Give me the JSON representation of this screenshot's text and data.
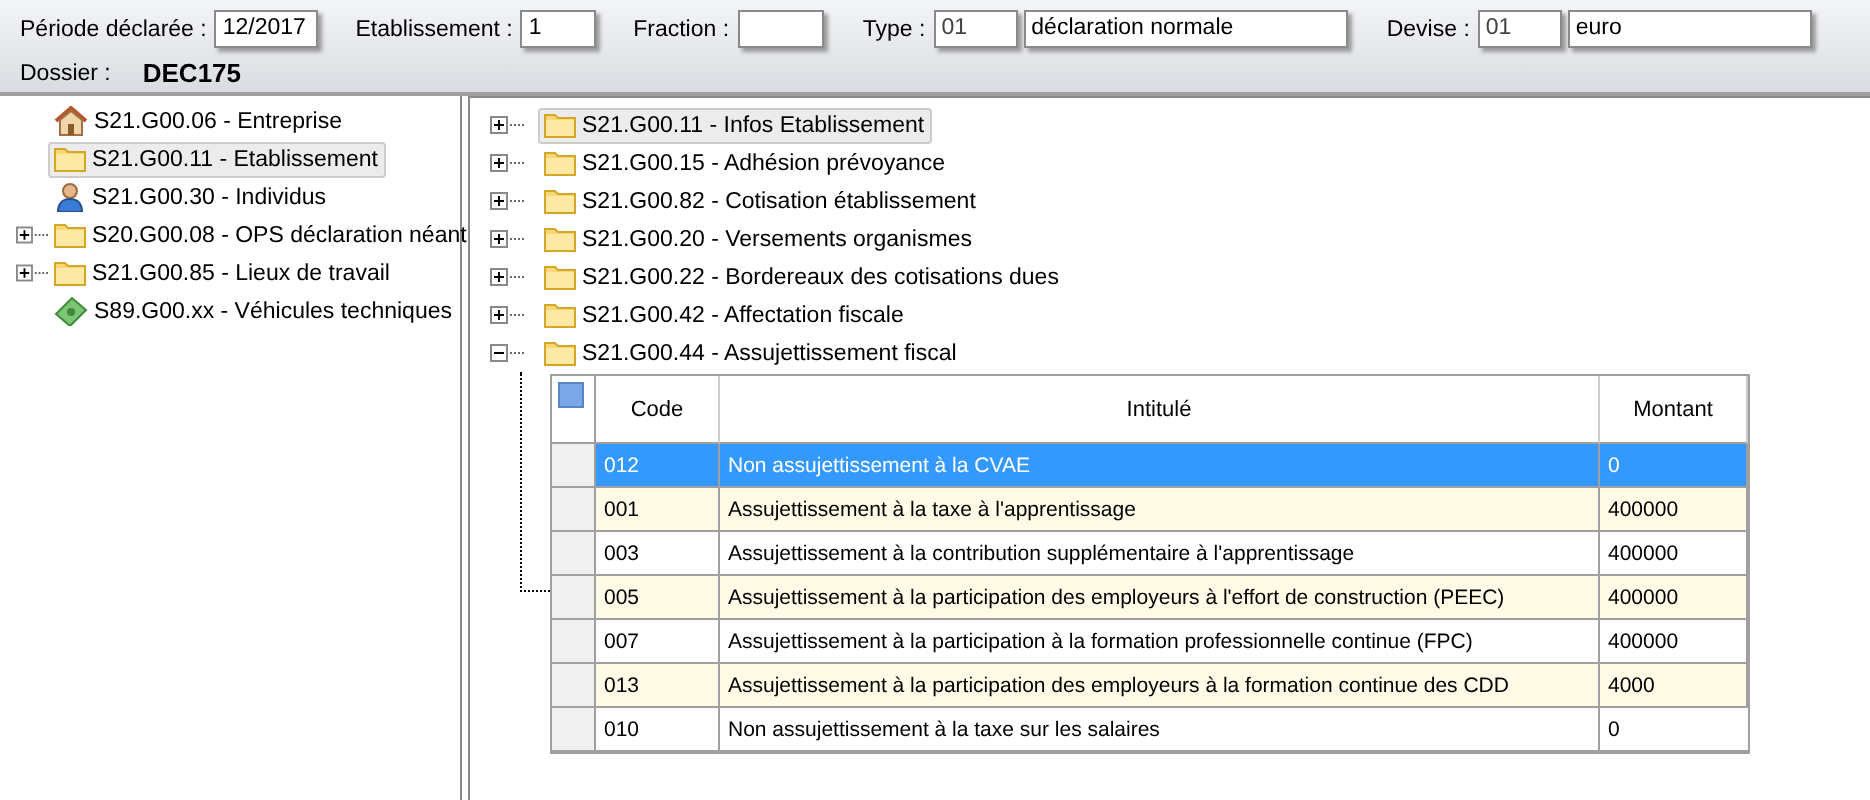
{
  "header": {
    "fields": [
      {
        "label": "Période déclarée :",
        "value": "12/2017",
        "kind": "plain"
      },
      {
        "label": "Etablissement :",
        "value": "1",
        "kind": "plain"
      },
      {
        "label": "Fraction :",
        "kind": "plain"
      },
      {
        "label": "Type :",
        "value": "01",
        "description": "déclaration normale",
        "kind": "coded"
      },
      {
        "label": "Devise :",
        "value": "01",
        "description": "euro",
        "kind": "coded"
      }
    ],
    "dossier": {
      "label": "Dossier :",
      "value": "DEC175"
    }
  },
  "left_tree": {
    "items": [
      {
        "label": "S21.G00.06 - Entreprise",
        "kind": "leaf",
        "selected": false
      },
      {
        "label": "S21.G00.11 - Etablissement",
        "kind": "leaf",
        "selected": true
      },
      {
        "label": "S21.G00.30 - Individus",
        "kind": "leaf",
        "selected": false
      },
      {
        "label": "S20.G00.08 - OPS déclaration néant",
        "kind": "group",
        "expanded": false,
        "selected": false
      },
      {
        "label": "S21.G00.85 - Lieux de travail",
        "kind": "group",
        "expanded": false,
        "selected": false
      },
      {
        "label": "S89.G00.xx - Véhicules techniques",
        "kind": "leaf",
        "selected": false
      }
    ]
  },
  "right_tree": {
    "items": [
      {
        "label": "S21.G00.11 - Infos Etablissement",
        "expanded": false,
        "selected": true
      },
      {
        "label": "S21.G00.15 - Adhésion prévoyance",
        "expanded": false,
        "selected": false
      },
      {
        "label": "S21.G00.82 - Cotisation établissement",
        "expanded": false,
        "selected": false
      },
      {
        "label": "S21.G00.20 - Versements organismes",
        "expanded": false,
        "selected": false
      },
      {
        "label": "S21.G00.22 - Bordereaux des cotisations dues",
        "expanded": false,
        "selected": false
      },
      {
        "label": "S21.G00.42 - Affectation fiscale",
        "expanded": false,
        "selected": false
      },
      {
        "label": "S21.G00.44 - Assujettissement fiscal",
        "expanded": true,
        "selected": false
      }
    ]
  },
  "table": {
    "columns": [
      "Code",
      "Intitulé",
      "Montant"
    ],
    "rows": [
      {
        "code": "012",
        "label": "Non assujettissement à la CVAE",
        "amount": "0",
        "selected": true
      },
      {
        "code": "001",
        "label": "Assujettissement à la taxe à l'apprentissage",
        "amount": "400000",
        "selected": false
      },
      {
        "code": "003",
        "label": "Assujettissement à la contribution supplémentaire à l'apprentissage",
        "amount": "400000",
        "selected": false
      },
      {
        "code": "005",
        "label": "Assujettissement à la participation des employeurs à l'effort de construction (PEEC)",
        "amount": "400000",
        "selected": false
      },
      {
        "code": "007",
        "label": "Assujettissement à la participation à la formation professionnelle continue (FPC)",
        "amount": "400000",
        "selected": false
      },
      {
        "code": "013",
        "label": "Assujettissement à la participation des employeurs à la formation continue des CDD",
        "amount": "4000",
        "selected": false
      },
      {
        "code": "010",
        "label": "Non assujettissement à la taxe sur les salaires",
        "amount": "0",
        "selected": false
      }
    ]
  }
}
